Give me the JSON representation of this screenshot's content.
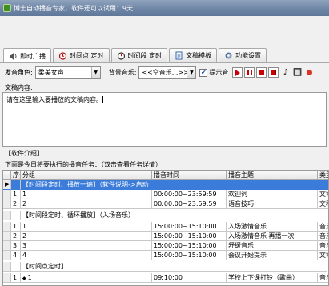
{
  "window": {
    "title": "博士自动播音专家，软件还可以试用：9天"
  },
  "tabs": [
    {
      "label": "即时广播",
      "icon": "speaker-icon"
    },
    {
      "label": "时间点 定时",
      "icon": "alarm-clock-icon"
    },
    {
      "label": "时间段 定时",
      "icon": "stopwatch-icon"
    },
    {
      "label": "文稿模板",
      "icon": "document-icon"
    },
    {
      "label": "功能设置",
      "icon": "gear-icon"
    }
  ],
  "toolbar": {
    "voice_label": "发音角色:",
    "voice_value": "柔美女声",
    "music_label": "背景音乐:",
    "music_value": "<<空音乐...>>",
    "prompt_label": "提示音",
    "prompt_checked": true
  },
  "editor": {
    "label": "文稿内容:",
    "content": "请在这里输入要播放的文稿内容。"
  },
  "info_label": "【软件介绍】",
  "task_caption": "下面是今日将要执行的播音任务：（双击查看任务详情）",
  "grid": {
    "headers": [
      "序号",
      "分组",
      "播音时间",
      "播音主题",
      "类型"
    ],
    "groups": [
      {
        "title": "【时间段定时、播放一遍】（软件说明->启动",
        "selected": true,
        "rows": [
          {
            "no": "1",
            "group": "1",
            "time": "00:00:00~23:59:59",
            "theme": "欢迎词",
            "type": "文稿"
          },
          {
            "no": "2",
            "group": "2",
            "time": "00:00:00~23:59:59",
            "theme": "语音技巧",
            "type": "文稿"
          }
        ]
      },
      {
        "title": "【时间段定时、循环播放】（入场音乐）",
        "selected": false,
        "rows": [
          {
            "no": "1",
            "group": "1",
            "time": "15:00:00~15:10:00",
            "theme": "入场激情音乐",
            "type": "音乐"
          },
          {
            "no": "2",
            "group": "2",
            "time": "15:00:00~15:10:00",
            "theme": "入场激情音乐 再播一次",
            "type": "音乐"
          },
          {
            "no": "3",
            "group": "3",
            "time": "15:00:00~15:10:00",
            "theme": "舒缓音乐",
            "type": "音乐"
          },
          {
            "no": "4",
            "group": "4",
            "time": "15:00:00~15:10:00",
            "theme": "会议开始提示",
            "type": "文稿"
          }
        ]
      },
      {
        "title": "【时间点定时】",
        "selected": false,
        "rows": [
          {
            "no": "1",
            "group": "1",
            "time": "09:10:00",
            "theme": "学校上下课打铃（歌曲）",
            "type": "音乐"
          }
        ]
      }
    ]
  }
}
